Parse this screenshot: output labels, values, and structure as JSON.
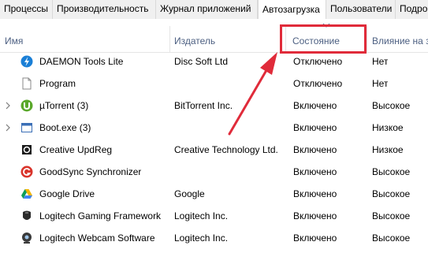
{
  "tabs": [
    {
      "label": "Процессы"
    },
    {
      "label": "Производительность"
    },
    {
      "label": "Журнал приложений"
    },
    {
      "label": "Автозагрузка"
    },
    {
      "label": "Пользователи"
    },
    {
      "label": "Подро"
    }
  ],
  "columns": {
    "name": "Имя",
    "publisher": "Издатель",
    "status": "Состояние",
    "impact": "Влияние на з"
  },
  "rows": [
    {
      "name": "DAEMON Tools Lite",
      "publisher": "Disc Soft Ltd",
      "status": "Отключено",
      "impact": "Нет",
      "icon": "daemon-tools-icon",
      "expandable": false
    },
    {
      "name": "Program",
      "publisher": "",
      "status": "Отключено",
      "impact": "Нет",
      "icon": "blank-file-icon",
      "expandable": false
    },
    {
      "name": "µTorrent (3)",
      "publisher": "BitTorrent Inc.",
      "status": "Включено",
      "impact": "Высокое",
      "icon": "utorrent-icon",
      "expandable": true
    },
    {
      "name": "Boot.exe (3)",
      "publisher": "",
      "status": "Включено",
      "impact": "Низкое",
      "icon": "app-window-icon",
      "expandable": true
    },
    {
      "name": "Creative UpdReg",
      "publisher": "Creative Technology Ltd.",
      "status": "Включено",
      "impact": "Низкое",
      "icon": "creative-icon",
      "expandable": false
    },
    {
      "name": "GoodSync Synchronizer",
      "publisher": "",
      "status": "Включено",
      "impact": "Высокое",
      "icon": "goodsync-icon",
      "expandable": false
    },
    {
      "name": "Google Drive",
      "publisher": "Google",
      "status": "Включено",
      "impact": "Высокое",
      "icon": "google-drive-icon",
      "expandable": false
    },
    {
      "name": "Logitech Gaming Framework",
      "publisher": "Logitech Inc.",
      "status": "Включено",
      "impact": "Высокое",
      "icon": "logitech-gaming-icon",
      "expandable": false
    },
    {
      "name": "Logitech Webcam Software",
      "publisher": "Logitech Inc.",
      "status": "Включено",
      "impact": "Высокое",
      "icon": "logitech-webcam-icon",
      "expandable": false
    }
  ],
  "colors": {
    "highlight": "#e02b3a",
    "header_text": "#4d6082"
  }
}
